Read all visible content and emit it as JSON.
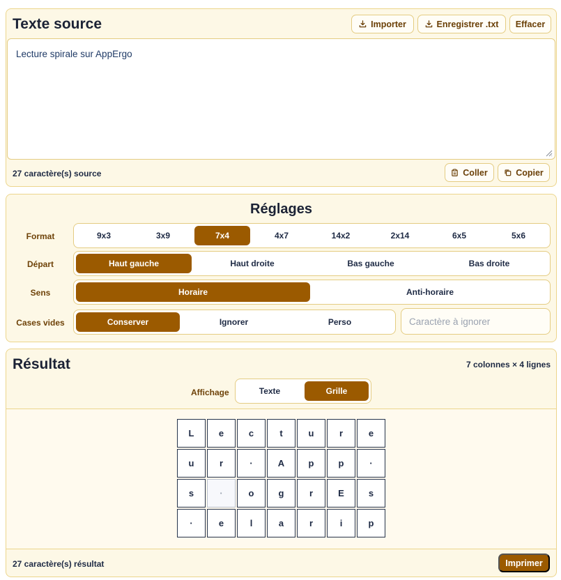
{
  "source": {
    "title": "Texte source",
    "import_label": "Importer",
    "save_label": "Enregistrer .txt",
    "clear_label": "Effacer",
    "text": "Lecture spirale sur AppErgo",
    "count_text": "27 caractère(s) source",
    "paste_label": "Coller",
    "copy_label": "Copier"
  },
  "settings": {
    "title": "Réglages",
    "format": {
      "label": "Format",
      "options": [
        "9x3",
        "3x9",
        "7x4",
        "4x7",
        "14x2",
        "2x14",
        "6x5",
        "5x6"
      ],
      "selected": "7x4"
    },
    "start": {
      "label": "Départ",
      "options": [
        "Haut gauche",
        "Haut droite",
        "Bas gauche",
        "Bas droite"
      ],
      "selected": "Haut gauche"
    },
    "direction": {
      "label": "Sens",
      "options": [
        "Horaire",
        "Anti-horaire"
      ],
      "selected": "Horaire"
    },
    "empty_cells": {
      "label": "Cases vides",
      "options": [
        "Conserver",
        "Ignorer",
        "Perso"
      ],
      "selected": "Conserver",
      "placeholder": "Caractère à ignorer"
    }
  },
  "result": {
    "title": "Résultat",
    "dimensions": "7 colonnes × 4 lignes",
    "display_label": "Affichage",
    "display_options": [
      "Texte",
      "Grille"
    ],
    "display_selected": "Grille",
    "grid": [
      [
        "L",
        "e",
        "c",
        "t",
        "u",
        "r",
        "e"
      ],
      [
        "u",
        "r",
        "·",
        "A",
        "p",
        "p",
        "·"
      ],
      [
        "s",
        "·",
        "o",
        "g",
        "r",
        "E",
        "s"
      ],
      [
        "·",
        "e",
        "l",
        "a",
        "r",
        "i",
        "p"
      ]
    ],
    "empty_cell": [
      2,
      1
    ],
    "count_text": "27 caractère(s) résultat",
    "print_label": "Imprimer"
  },
  "colors": {
    "accent": "#9b5a00",
    "card_bg": "#fdf8e6",
    "card_border": "#ecd58c",
    "label_brown": "#6e4208",
    "text_navy": "#1e2a44"
  }
}
